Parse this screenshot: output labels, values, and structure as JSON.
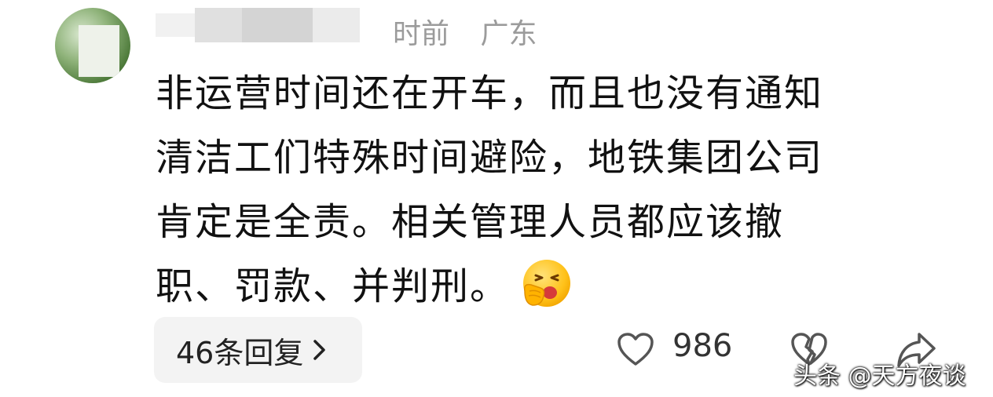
{
  "comment": {
    "meta_time": "时前",
    "meta_location": "广东",
    "lines": [
      "非运营时间还在开车，而且也没有通知",
      "清洁工们特殊时间避险，地铁集团公司",
      "肯定是全责。相关管理人员都应该撤",
      "职、罚款、并判刑。"
    ],
    "emoji": "yawning-face-emoji"
  },
  "actions": {
    "replies_label": "46条回复",
    "like_count": "986",
    "like_icon": "heart-outline-icon",
    "dislike_icon": "broken-heart-icon",
    "share_icon": "share-arrow-icon"
  },
  "watermark": "头条 @天方夜谈",
  "colors": {
    "text": "#111111",
    "meta": "#9b9b9b",
    "pill_bg": "#f3f3f3"
  }
}
